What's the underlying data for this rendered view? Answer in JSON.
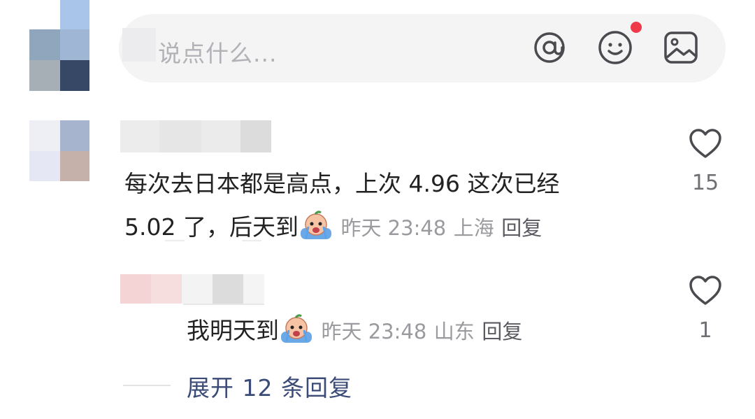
{
  "composer": {
    "placeholder": "说点什么...",
    "icons": [
      "at-icon",
      "emoji-icon",
      "image-icon"
    ],
    "has_notification_dot": true
  },
  "comments": [
    {
      "text_line1": "每次去日本都是高点，上次 4.96 这次已经",
      "text_line2": "5.02 了，后天到",
      "emoji": "crying-emoji",
      "time": "昨天 23:48",
      "location": "上海",
      "reply_label": "回复",
      "likes": "15"
    },
    {
      "text": "我明天到",
      "emoji": "crying-emoji",
      "time": "昨天 23:48",
      "location": "山东",
      "reply_label": "回复",
      "likes": "1"
    }
  ],
  "expand_replies": "展开 12 条回复",
  "colors": {
    "text": "#222222",
    "meta": "#9a9a9f",
    "link": "#3b4b77",
    "input_bg": "#f4f4f5",
    "dot": "#ef3a4a"
  }
}
